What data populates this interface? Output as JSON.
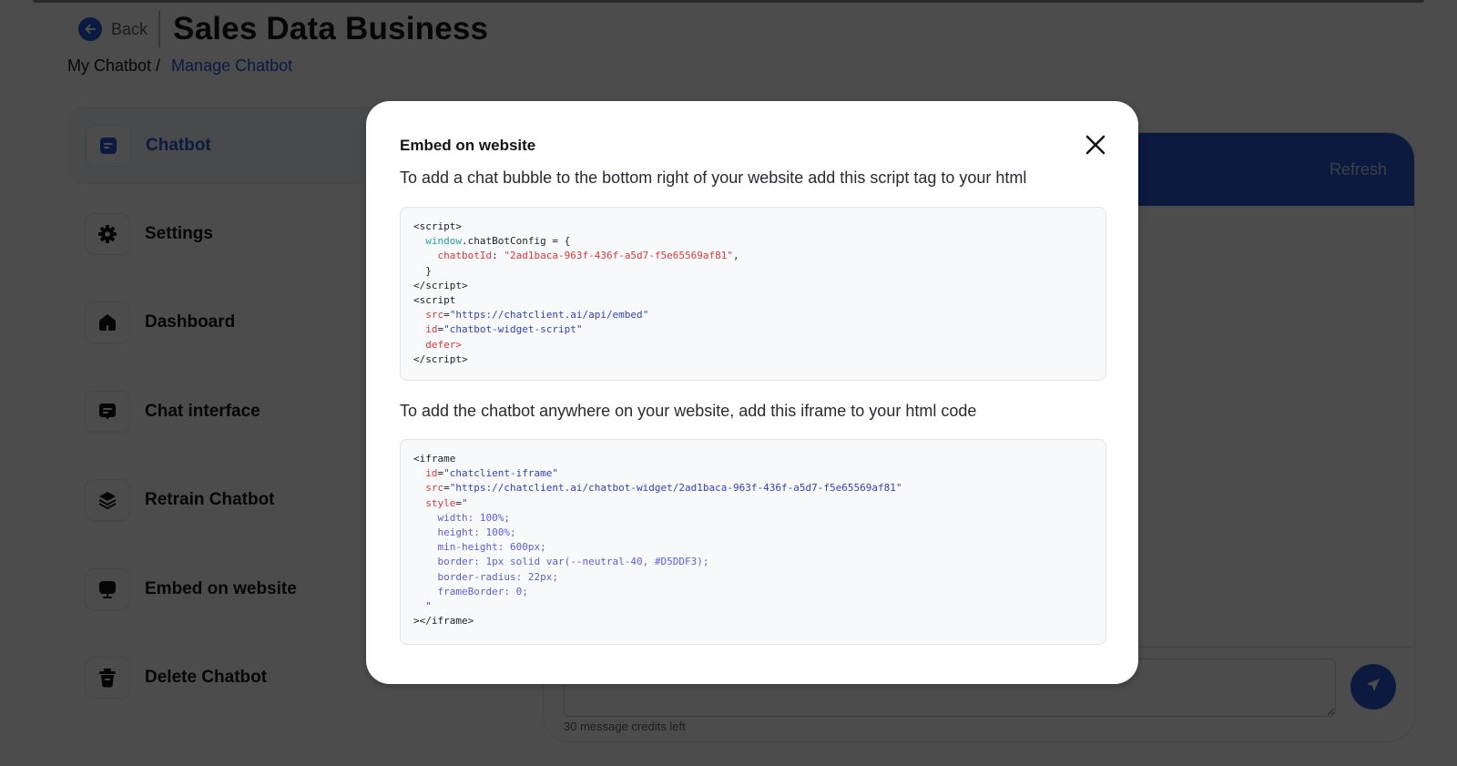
{
  "header": {
    "back_label": "Back",
    "title": "Sales Data Business"
  },
  "breadcrumb": {
    "root": "My Chatbot /",
    "current": "Manage Chatbot"
  },
  "sidebar": {
    "items": [
      {
        "label": "Chatbot",
        "icon": "chat-square-icon",
        "active": true
      },
      {
        "label": "Settings",
        "icon": "gear-icon",
        "active": false
      },
      {
        "label": "Dashboard",
        "icon": "home-icon",
        "active": false
      },
      {
        "label": "Chat interface",
        "icon": "message-icon",
        "active": false
      },
      {
        "label": "Retrain Chatbot",
        "icon": "layers-icon",
        "active": false
      },
      {
        "label": "Embed on website",
        "icon": "monitor-icon",
        "active": false
      },
      {
        "label": "Delete Chatbot",
        "icon": "trash-icon",
        "active": false
      }
    ]
  },
  "chat_panel": {
    "refresh_label": "Refresh",
    "input_placeholder": "",
    "credits_text": "30 message credits left"
  },
  "modal": {
    "title": "Embed on website",
    "script_description": "To add a chat bubble to the bottom right of your website add this script tag to your html",
    "iframe_description": "To add the chatbot anywhere on your website, add this iframe to your html code",
    "script_code": {
      "chatbot_id": "2ad1baca-963f-436f-a5d7-f5e65569af81",
      "src": "https://chatclient.ai/api/embed",
      "id": "chatbot-widget-script"
    },
    "iframe_code": {
      "id": "chatclient-iframe",
      "src": "https://chatclient.ai/chatbot-widget/2ad1baca-963f-436f-a5d7-f5e65569af81",
      "width": "100%;",
      "height": "100%;",
      "min_height": "600px;",
      "border": "1px solid var(--neutral-40, #D5DDF3);",
      "border_radius": "22px;",
      "frame_border": "0;"
    }
  },
  "colors": {
    "brand_blue": "#2557d6",
    "header_blue": "#2b58d8",
    "overlay": "rgba(0,0,0,0.70)"
  }
}
